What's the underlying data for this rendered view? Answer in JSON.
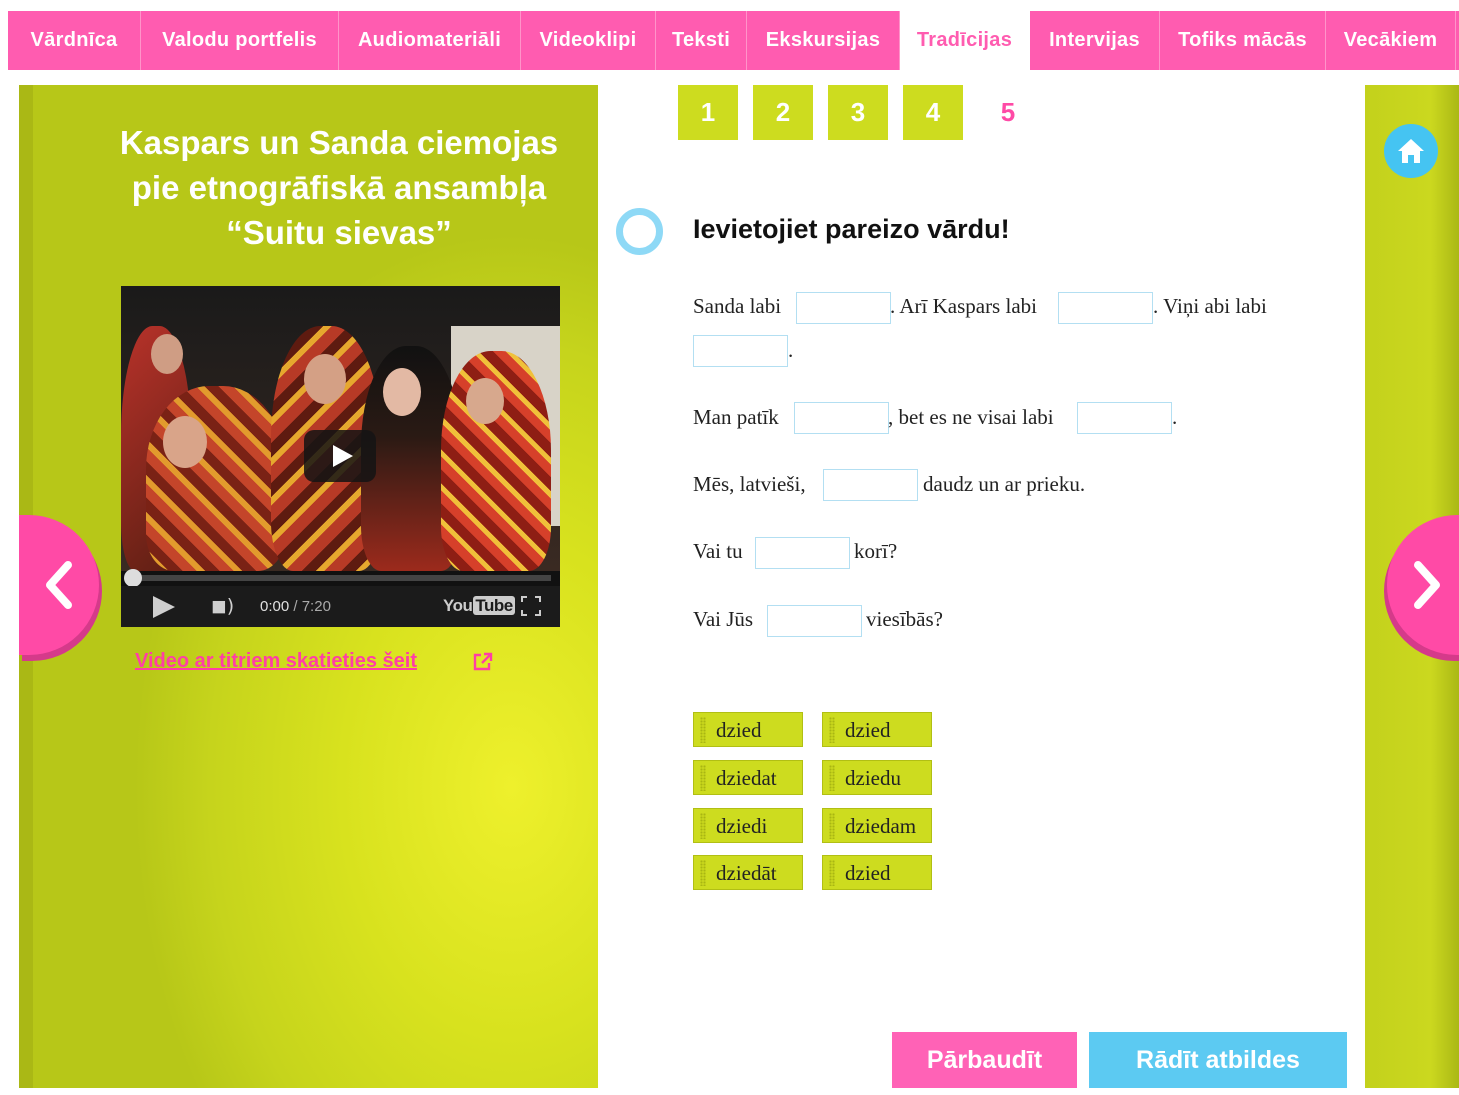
{
  "nav": {
    "tabs": [
      {
        "label": "Vārdnīca"
      },
      {
        "label": "Valodu portfelis"
      },
      {
        "label": "Audiomateriāli"
      },
      {
        "label": "Videoklipi"
      },
      {
        "label": "Teksti"
      },
      {
        "label": "Ekskursijas"
      },
      {
        "label": "Tradīcijas",
        "active": true
      },
      {
        "label": "Intervijas"
      },
      {
        "label": "Tofiks mācās"
      },
      {
        "label": "Vecākiem"
      }
    ]
  },
  "panel": {
    "title_line1": "Kaspars un Sanda ciemojas",
    "title_line2": "pie etnogrāfiskā ansambļa",
    "title_line3": "“Suitu sievas”",
    "video": {
      "time_current": "0:00",
      "time_separator": " / ",
      "time_total": "7:20",
      "brand_you": "You",
      "brand_tube": "Tube",
      "progress": 0
    },
    "link_text": "Video ar titriem skatieties šeit"
  },
  "pager": {
    "pages": [
      "1",
      "2",
      "3",
      "4",
      "5"
    ],
    "current": "5"
  },
  "exercise": {
    "instruction": "Ievietojiet pareizo vārdu!",
    "s1_a": "Sanda labi",
    "s1_b": ". Arī Kaspars labi",
    "s1_c": ". Viņi abi labi",
    "s1_d": ".",
    "s2_a": "Man patīk",
    "s2_b": ", bet es ne visai labi",
    "s2_c": ".",
    "s3_a": "Mēs, latvieši,",
    "s3_b": "daudz un ar prieku.",
    "s4_a": "Vai tu",
    "s4_b": "korī?",
    "s5_a": "Vai Jūs",
    "s5_b": "viesībās?",
    "blanks": [
      "",
      "",
      "",
      "",
      "",
      "",
      "",
      ""
    ],
    "words": [
      "dzied",
      "dzied",
      "dziedat",
      "dziedu",
      "dziedi",
      "dziedam",
      "dziedāt",
      "dzied"
    ]
  },
  "buttons": {
    "check": "Pārbaudīt",
    "show_answers": "Rādīt atbildes"
  },
  "colors": {
    "nav_pink": "#ff5cb0",
    "panel_green": "#cddc1f",
    "accent_blue": "#5ccaf2"
  },
  "icons": {
    "home": "home-icon",
    "prev": "chevron-left-icon",
    "next": "chevron-right-icon",
    "external": "external-link-icon",
    "play": "play-icon",
    "volume": "volume-icon",
    "fullscreen": "fullscreen-icon"
  }
}
